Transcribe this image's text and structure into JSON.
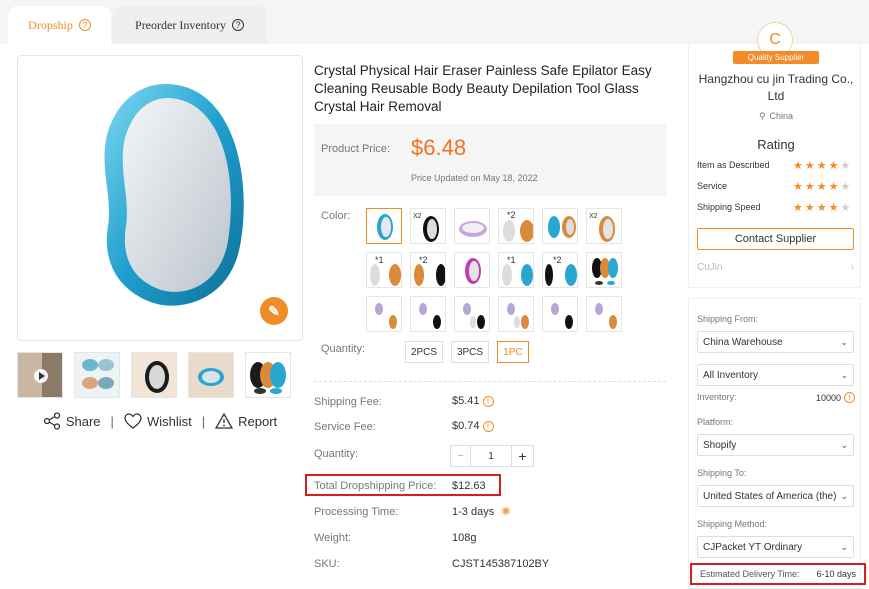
{
  "tabs": [
    {
      "label": "Dropship",
      "active": true
    },
    {
      "label": "Preorder Inventory",
      "active": false
    }
  ],
  "gallery": {
    "share": "Share",
    "wishlist": "Wishlist",
    "report": "Report"
  },
  "product": {
    "title": "Crystal Physical Hair Eraser Painless Safe Epilator Easy Cleaning Reusable Body Beauty Depilation Tool Glass Crystal Hair Removal",
    "price_label": "Product Price:",
    "price": "$6.48",
    "price_updated": "Price Updated on May 18, 2022",
    "color_label": "Color:",
    "quantity_label": "Quantity:",
    "quantity_options": [
      "2PCS",
      "3PCS",
      "1PC"
    ],
    "selected_quantity": "1PC"
  },
  "details": {
    "shipping_fee_label": "Shipping Fee:",
    "shipping_fee": "$5.41",
    "service_fee_label": "Service Fee:",
    "service_fee": "$0.74",
    "quantity_label": "Quantity:",
    "quantity": "1",
    "total_label": "Total Dropshipping Price:",
    "total": "$12.63",
    "processing_label": "Processing Time:",
    "processing": "1-3 days",
    "weight_label": "Weight:",
    "weight": "108g",
    "sku_label": "SKU:",
    "sku": "CJST145387102BY"
  },
  "supplier": {
    "avatar_letter": "C",
    "badge": "Quality Supplier",
    "name": "Hangzhou cu jin Trading Co., Ltd",
    "location": "China",
    "rating_title": "Rating",
    "ratings": [
      {
        "label": "Item as Described",
        "stars": 4
      },
      {
        "label": "Service",
        "stars": 4
      },
      {
        "label": "Shipping Speed",
        "stars": 4
      }
    ],
    "contact": "Contact Supplier",
    "store_link": "CuJin"
  },
  "shipping": {
    "from_label": "Shipping From:",
    "from": "China Warehouse",
    "inventory_select": "All Inventory",
    "inventory_label": "Inventory:",
    "inventory": "10000",
    "platform_label": "Platform:",
    "platform": "Shopify",
    "to_label": "Shipping To:",
    "to": "United States of America (the)",
    "method_label": "Shipping Method:",
    "method": "CJPacket YT Ordinary",
    "est_label": "Estimated Delivery Time:",
    "est": "6-10 days"
  },
  "colors": {
    "accent": "#f28c28",
    "price": "#f5701e",
    "highlight": "#d71d1d",
    "product_blue": "#2aa7d0"
  }
}
